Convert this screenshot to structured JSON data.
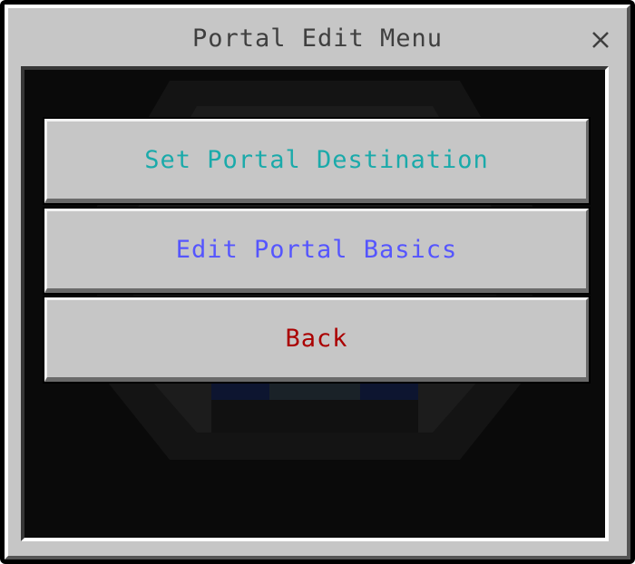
{
  "dialog": {
    "title": "Portal Edit Menu",
    "close_icon": "close-icon"
  },
  "buttons": [
    {
      "label": "Set Portal Destination",
      "color": "#1aaaaa"
    },
    {
      "label": "Edit Portal Basics",
      "color": "#5555ff"
    },
    {
      "label": "Back",
      "color": "#aa0000"
    }
  ],
  "colors": {
    "panel": "#c6c6c6",
    "title_text": "#3f3f3f",
    "content_bg": "#0a0a0a"
  }
}
